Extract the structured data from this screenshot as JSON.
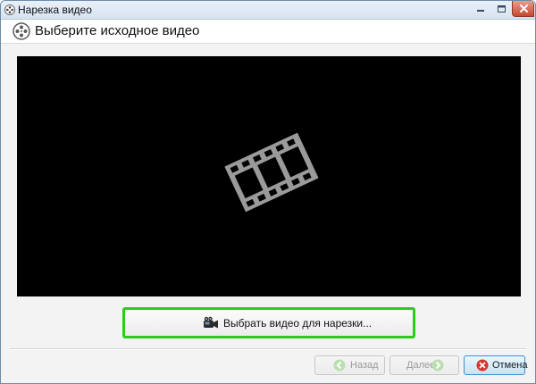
{
  "window": {
    "title": "Нарезка видео",
    "app_icon": "film-reel-icon",
    "controls": [
      "minimize-icon",
      "maximize-icon",
      "close-icon"
    ]
  },
  "header": {
    "title": "Выберите исходное видео",
    "icon": "film-reel-icon"
  },
  "preview": {
    "placeholder_icon": "film-strip-icon",
    "background": "#000000",
    "icon_color": "#9a9a9a"
  },
  "select_button": {
    "label": "Выбрать видео для нарезки...",
    "icon": "camcorder-icon",
    "highlight_color": "#2ecc1a"
  },
  "footer": {
    "back": {
      "label": "Назад",
      "icon": "arrow-left-icon",
      "enabled": false
    },
    "next": {
      "label": "Далее",
      "icon": "arrow-right-icon",
      "enabled": false
    },
    "cancel": {
      "label": "Отмена",
      "icon": "cancel-icon",
      "enabled": true,
      "color": "#d9342b"
    }
  }
}
